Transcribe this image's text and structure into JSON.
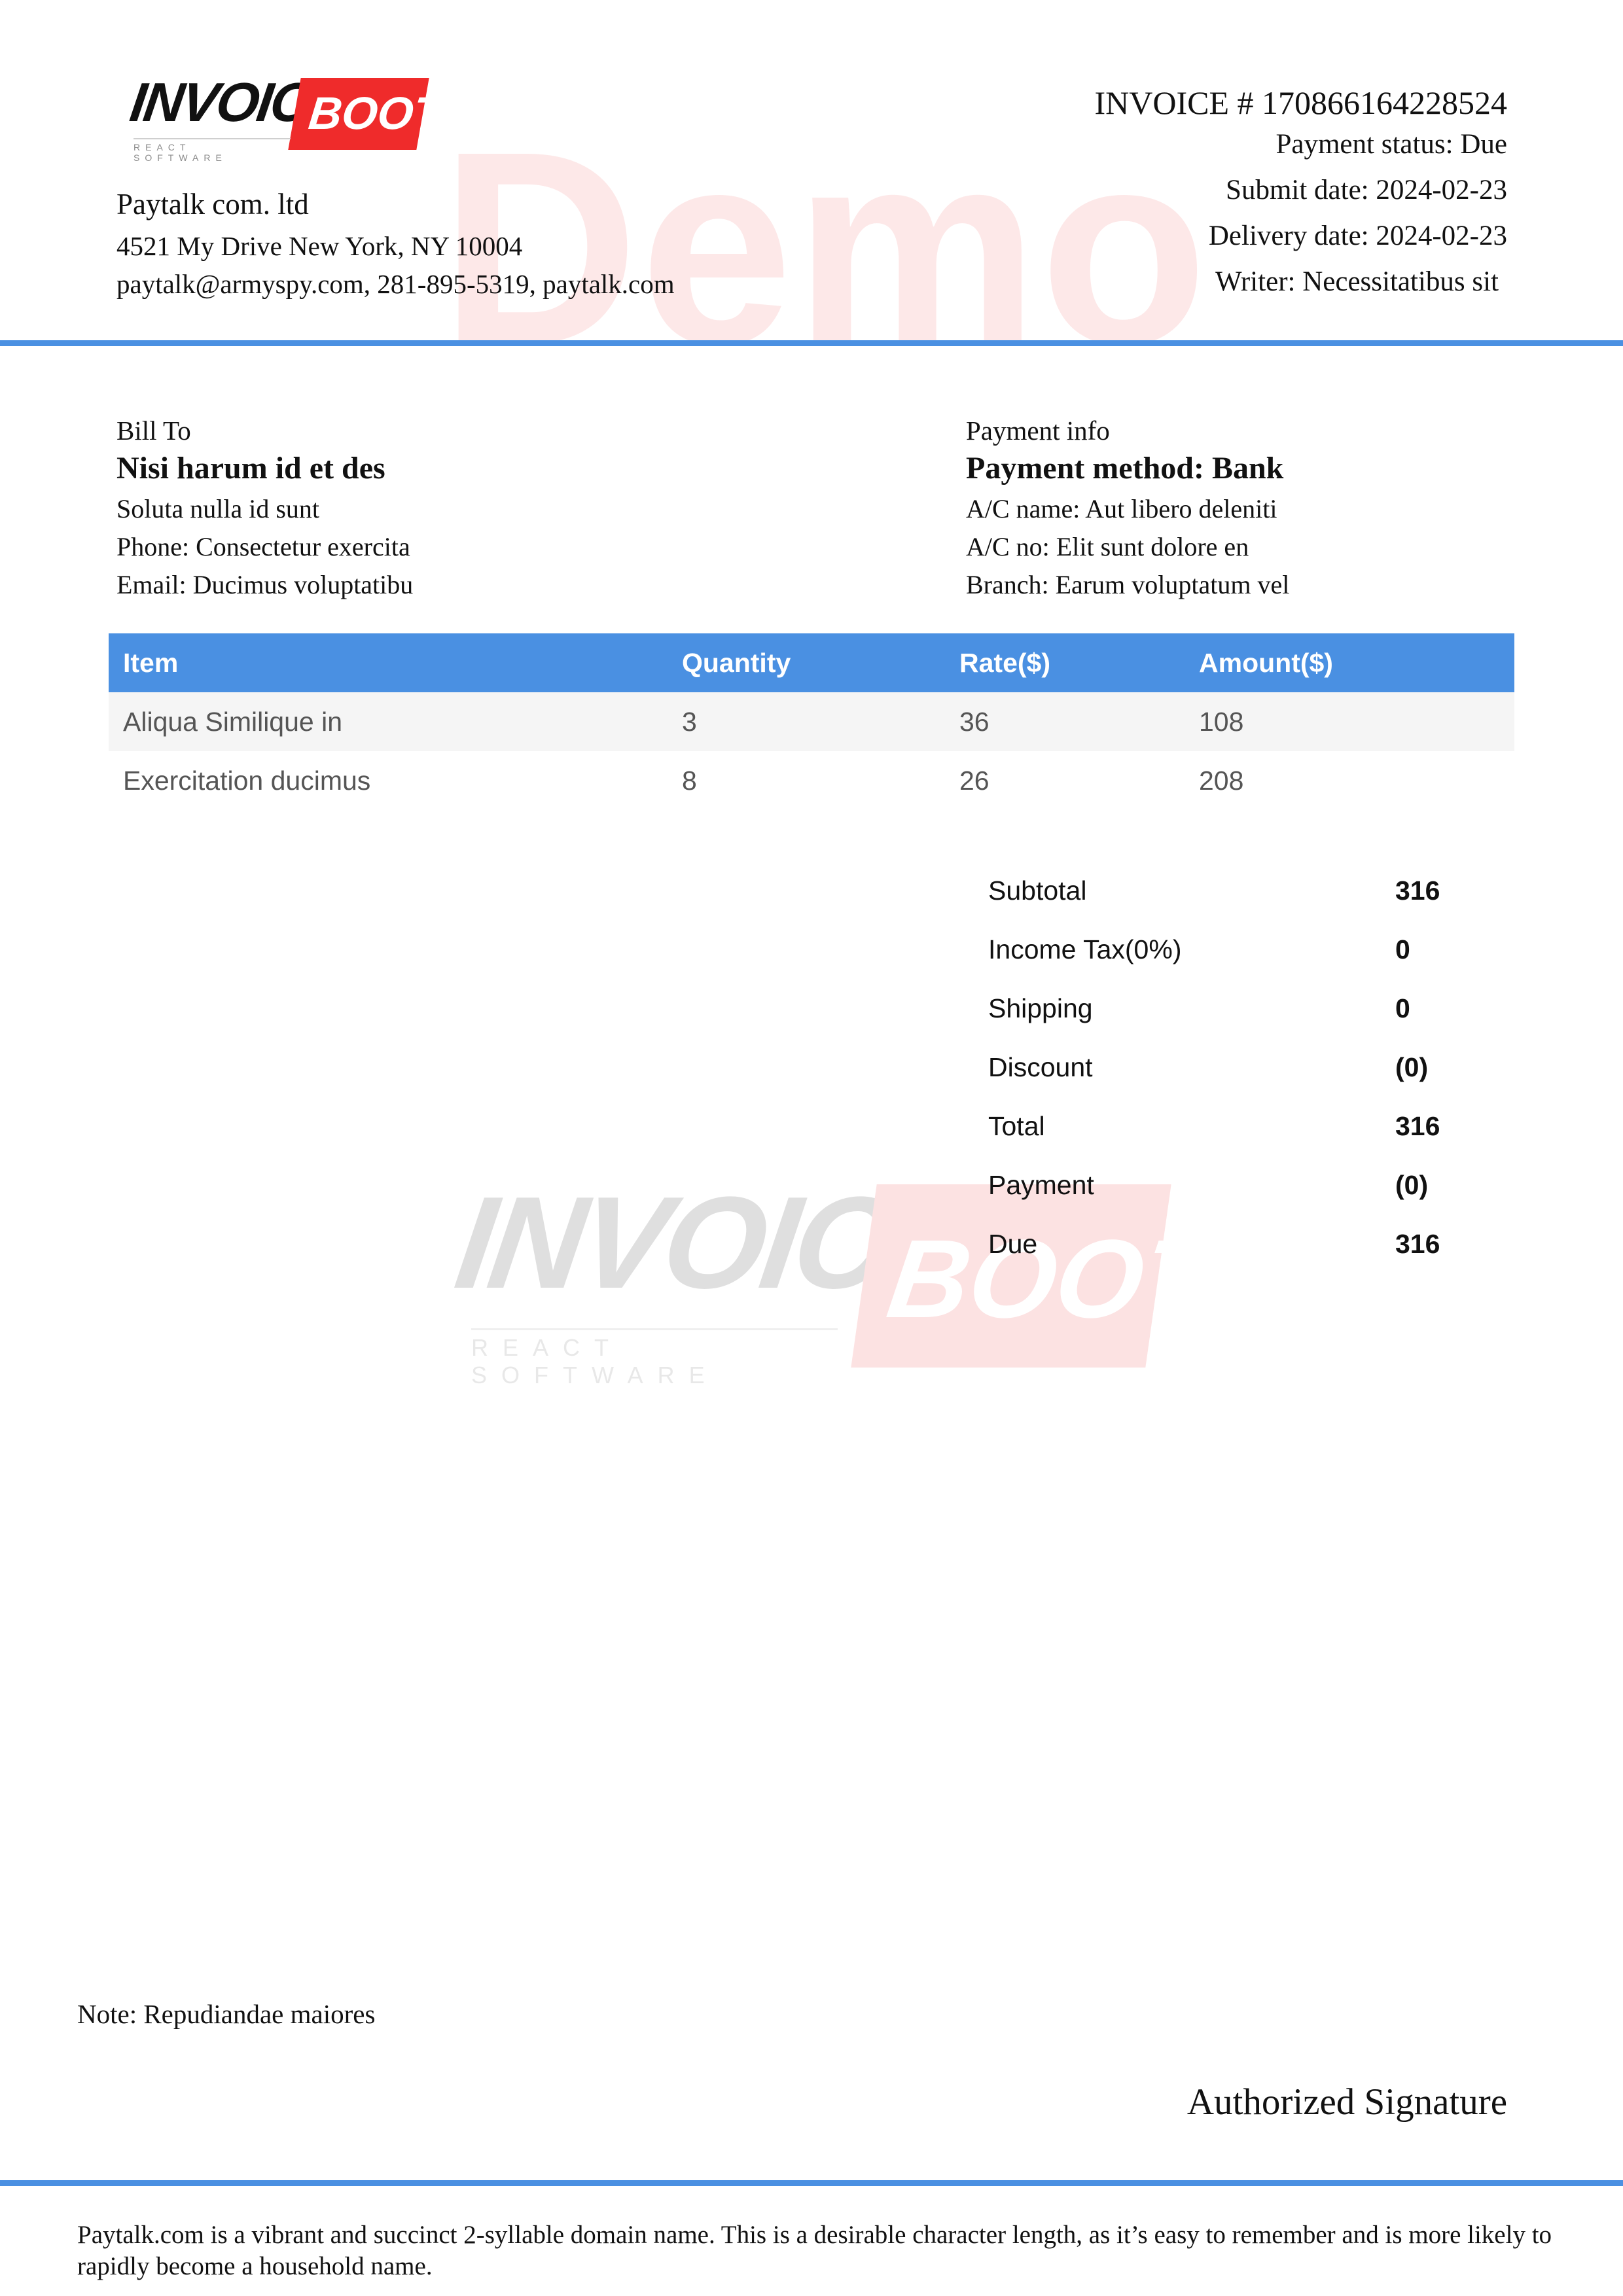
{
  "logo": {
    "word": "INVOICE",
    "badge": "BOOT",
    "tagline": "REACT SOFTWARE"
  },
  "watermark_text": "Demo",
  "company": {
    "name": "Paytalk com. ltd",
    "address": "4521 My Drive New York, NY 10004",
    "contact": "paytalk@armyspy.com, 281-895-5319, paytalk.com"
  },
  "invoice": {
    "number": "INVOICE # 170866164228524",
    "payment_status": "Payment status: Due",
    "submit_date": "Submit date:  2024-02-23",
    "delivery_date": "Delivery date:  2024-02-23",
    "writer": "Writer:  Necessitatibus sit"
  },
  "bill_to": {
    "label": "Bill To",
    "name": "Nisi harum id et des",
    "line1": "Soluta nulla id sunt",
    "phone": "Phone: Consectetur exercita",
    "email": "Email: Ducimus voluptatibu"
  },
  "payment_info": {
    "label": "Payment info",
    "method": "Payment method: Bank",
    "ac_name": "A/C name:  Aut libero deleniti",
    "ac_no": "A/C no: Elit sunt dolore en",
    "branch": "Branch: Earum voluptatum vel"
  },
  "table": {
    "headers": [
      "Item",
      "Quantity",
      "Rate($)",
      "Amount($)"
    ],
    "rows": [
      [
        "Aliqua Similique in",
        "3",
        "36",
        "108"
      ],
      [
        "Exercitation ducimus",
        "8",
        "26",
        "208"
      ]
    ]
  },
  "totals": [
    {
      "label": "Subtotal",
      "value": "316"
    },
    {
      "label": "Income Tax(0%)",
      "value": "0"
    },
    {
      "label": "Shipping",
      "value": "0"
    },
    {
      "label": "Discount",
      "value": "(0)"
    },
    {
      "label": "Total",
      "value": "316"
    },
    {
      "label": "Payment",
      "value": "(0)"
    },
    {
      "label": "Due",
      "value": "316"
    }
  ],
  "note": "Note: Repudiandae maiores",
  "signature": "Authorized Signature",
  "footer": "Paytalk.com is a vibrant and succinct 2-syllable domain name. This is a desirable character length, as it’s easy to remember and is more likely to rapidly become a household name.",
  "colors": {
    "accent": "#4a90e2",
    "brand_red": "#ef2b2b"
  }
}
